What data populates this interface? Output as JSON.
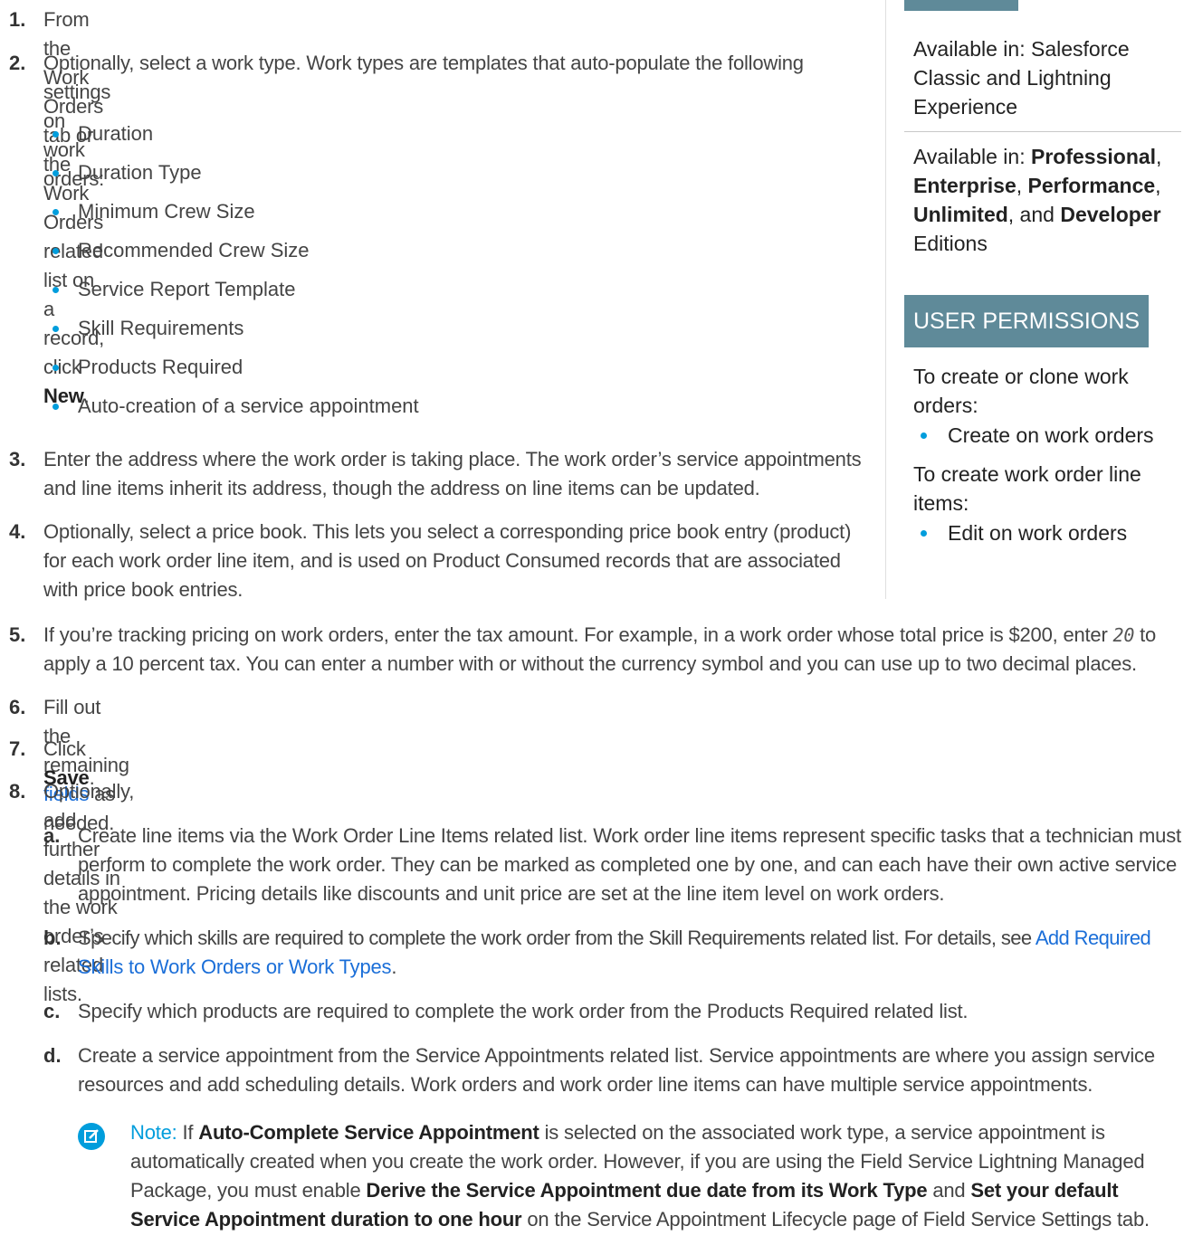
{
  "steps": {
    "s1": {
      "num": "1.",
      "pre": "From the Work Orders tab or the Work Orders related list on a record, click ",
      "bold": "New",
      "post": "."
    },
    "s2": {
      "num": "2.",
      "line1": "Optionally, select a work type. Work types are templates that auto-populate the following",
      "line2": "settings on work orders:"
    },
    "s2_bullets": [
      "Duration",
      "Duration Type",
      "Minimum Crew Size",
      "Recommended Crew Size",
      "Service Report Template",
      "Skill Requirements",
      "Products Required",
      "Auto-creation of a service appointment"
    ],
    "s3": {
      "num": "3.",
      "line1": "Enter the address where the work order is taking place. The work order’s service appointments",
      "line2": "and line items inherit its address, though the address on line items can be updated."
    },
    "s4": {
      "num": "4.",
      "line1": "Optionally, select a price book. This lets you select a corresponding price book entry (product)",
      "line2": "for each work order line item, and is used on Product Consumed records that are associated",
      "line3": "with price book entries."
    },
    "s5": {
      "num": "5.",
      "line1_pre": "If you’re tracking pricing on work orders, enter the tax amount. For example, in a work order whose total price is $200, enter ",
      "code": "20",
      "line1_post": " to",
      "line2": "apply a 10 percent tax. You can enter a number with or without the currency symbol and you can use up to two decimal places."
    },
    "s6": {
      "num": "6.",
      "pre": "Fill out the remaining ",
      "link": "fields",
      "post": " as needed."
    },
    "s7": {
      "num": "7.",
      "pre": "Click ",
      "bold": "Save",
      "post": "."
    },
    "s8": {
      "num": "8.",
      "text": "Optionally, add further details in the work order’s related lists."
    },
    "s8a": {
      "num": "a.",
      "line1": "Create line items via the Work Order Line Items related list. Work order line items represent specific tasks that a technician must",
      "line2": "perform to complete the work order. They can be marked as completed one by one, and can each have their own active service",
      "line3": "appointment. Pricing details like discounts and unit price are set at the line item level on work orders."
    },
    "s8b": {
      "num": "b.",
      "line1": "Specify which skills are required to complete the work order from the Skill Requirements related list. For details, see ",
      "link1": "Add Required",
      "link2": "Skills to Work Orders or Work Types",
      "post": "."
    },
    "s8c": {
      "num": "c.",
      "text": "Specify which products are required to complete the work order from the Products Required related list."
    },
    "s8d": {
      "num": "d.",
      "line1": "Create a service appointment from the Service Appointments related list. Service appointments are where you assign service",
      "line2": "resources and add scheduling details. Work orders and work order line items can have multiple service appointments."
    }
  },
  "note": {
    "label": "Note:",
    "l1_pre": " If ",
    "l1_bold": "Auto-Complete Service Appointment",
    "l1_post": " is selected on the associated work type, a service appointment is",
    "l2": "automatically created when you create the work order. However, if you are using the Field Service Lightning Managed",
    "l3_pre": "Package, you must enable ",
    "l3_bold1": "Derive the Service Appointment due date from its Work Type",
    "l3_mid": " and ",
    "l3_bold2": "Set your default",
    "l4_bold": "Service Appointment duration to one hour",
    "l4_post": " on the Service Appointment Lifecycle page of Field Service Settings tab."
  },
  "sidebar": {
    "avail1": [
      "Available in: Salesforce",
      "Classic and Lightning",
      "Experience"
    ],
    "avail2_pre": "Available in: ",
    "ed1": "Professional",
    "ed2": "Enterprise",
    "ed3": "Performance",
    "ed4": "Unlimited",
    "and": ", and ",
    "ed5": "Developer",
    "editions": "Editions",
    "perm_heading": "USER PERMISSIONS",
    "perm1_l1": "To create or clone work",
    "perm1_l2": "orders:",
    "perm1_bullet": "Create on work orders",
    "perm2_l1": "To create work order line",
    "perm2_l2": "items:",
    "perm2_bullet": "Edit on work orders"
  },
  "colors": {
    "accent": "#009ddc",
    "link": "#1a6ed8",
    "header_bg": "#5f8a99"
  }
}
